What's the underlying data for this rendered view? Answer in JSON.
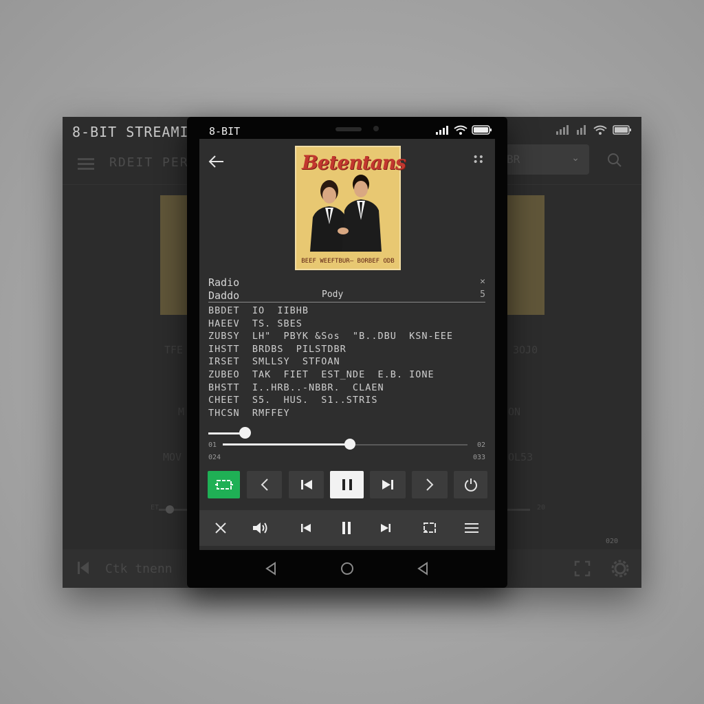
{
  "desktop": {
    "title": "8-BIT STREAMIN",
    "nav_text": "RDEIT PERI",
    "select_value": "BR",
    "ghost_left_1": "TFE",
    "ghost_left_2": "M",
    "ghost_left_3": "MOV",
    "ghost_right_1": "3OJ0",
    "ghost_right_2": "ON",
    "ghost_right_3": "OL53",
    "slider_left": "ET",
    "slider_right": "20",
    "bottom_text": "Ctk tnenn",
    "bottom_right_small": "020"
  },
  "phone": {
    "status_left": "8-BIT",
    "album": {
      "title": "Betentans",
      "caption": "BEEF WEEFTBUR— BORBEF ODB"
    },
    "station_label": "Radio",
    "station_name": "Daddo",
    "podcast_label": "Pody",
    "close_small": "✕",
    "count": "5",
    "tracks": [
      "BBDET  IO  IIBHB",
      "HAEEV  TS. SBES",
      "ZUBSY  LH\"  PBYK &Sos  \"B..DBU  KSN-EEE",
      "IHSTT  BRDBS  PILSTDBR",
      "IRSET  SMLLSY  STFOAN",
      "ZUBEO  TAK  FIET  EST_NDE  E.B. IONE",
      "BHSTT  I..HRB..-NBBR.  CLAEN",
      "CHEET  S5.  HUS.  S1..STRIS",
      "THCSN  RMFFEY"
    ],
    "time_left": "01",
    "time_right": "02",
    "duration_left": "024",
    "duration_right": "033",
    "progress_fraction": 0.52,
    "volume_fraction": 0.9
  },
  "colors": {
    "accent_green": "#1fb055",
    "screen_bg": "#2e2e2e",
    "album_bg": "#e8c872"
  },
  "icons": {
    "controls": [
      "repeat-icon",
      "chevron-left-icon",
      "skip-back-icon",
      "pause-icon",
      "skip-forward-icon",
      "chevron-right-icon",
      "power-icon"
    ],
    "bottom_bar": [
      "close-icon",
      "volume-icon",
      "skip-back-icon",
      "pause-icon",
      "skip-forward-icon",
      "cast-icon",
      "menu-icon"
    ],
    "nav": [
      "back-triangle-icon",
      "home-circle-icon",
      "recent-triangle-icon"
    ]
  }
}
